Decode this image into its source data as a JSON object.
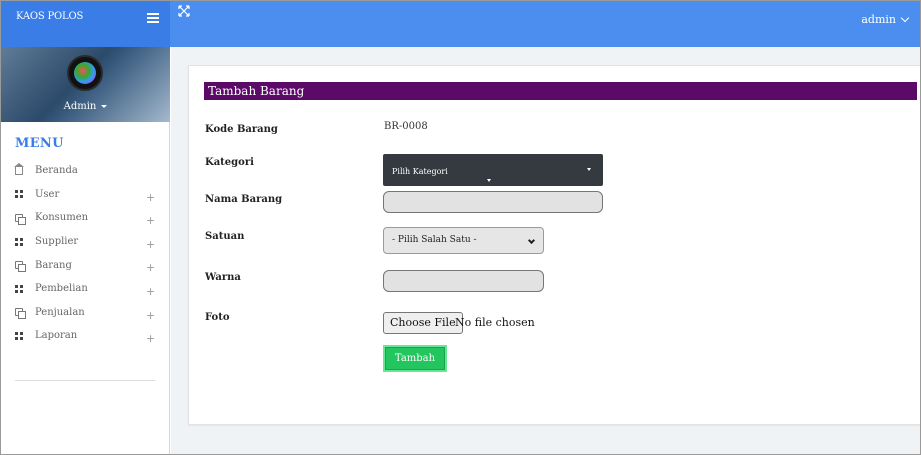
{
  "header": {
    "brand": "KAOS POLOS",
    "user": "admin"
  },
  "sidebar": {
    "profile_name": "Admin",
    "menu_heading": "MENU",
    "items": [
      {
        "label": "Beranda",
        "icon": "home-icon",
        "expandable": false
      },
      {
        "label": "User",
        "icon": "grid-icon",
        "expandable": true
      },
      {
        "label": "Konsumen",
        "icon": "window-icon",
        "expandable": true
      },
      {
        "label": "Supplier",
        "icon": "grid-icon",
        "expandable": true
      },
      {
        "label": "Barang",
        "icon": "window-icon",
        "expandable": true
      },
      {
        "label": "Pembelian",
        "icon": "grid-icon",
        "expandable": true
      },
      {
        "label": "Penjualan",
        "icon": "window-icon",
        "expandable": true
      },
      {
        "label": "Laporan",
        "icon": "grid-icon",
        "expandable": true
      }
    ],
    "expand_symbol": "+"
  },
  "form": {
    "title": "Tambah Barang",
    "kode_label": "Kode Barang",
    "kode_value": "BR-0008",
    "kategori_label": "Kategori",
    "kategori_selected": "Pilih Kategori",
    "nama_label": "Nama Barang",
    "nama_value": "",
    "satuan_label": "Satuan",
    "satuan_selected": "- Pilih Salah Satu -",
    "warna_label": "Warna",
    "warna_value": "",
    "foto_label": "Foto",
    "file_button": "Choose File",
    "file_status": "No file chosen",
    "submit_label": "Tambah"
  },
  "colors": {
    "topbar": "#4c8ef0",
    "title_bar": "#5c0a68",
    "submit": "#22c55e",
    "dark_select": "#343a40"
  }
}
